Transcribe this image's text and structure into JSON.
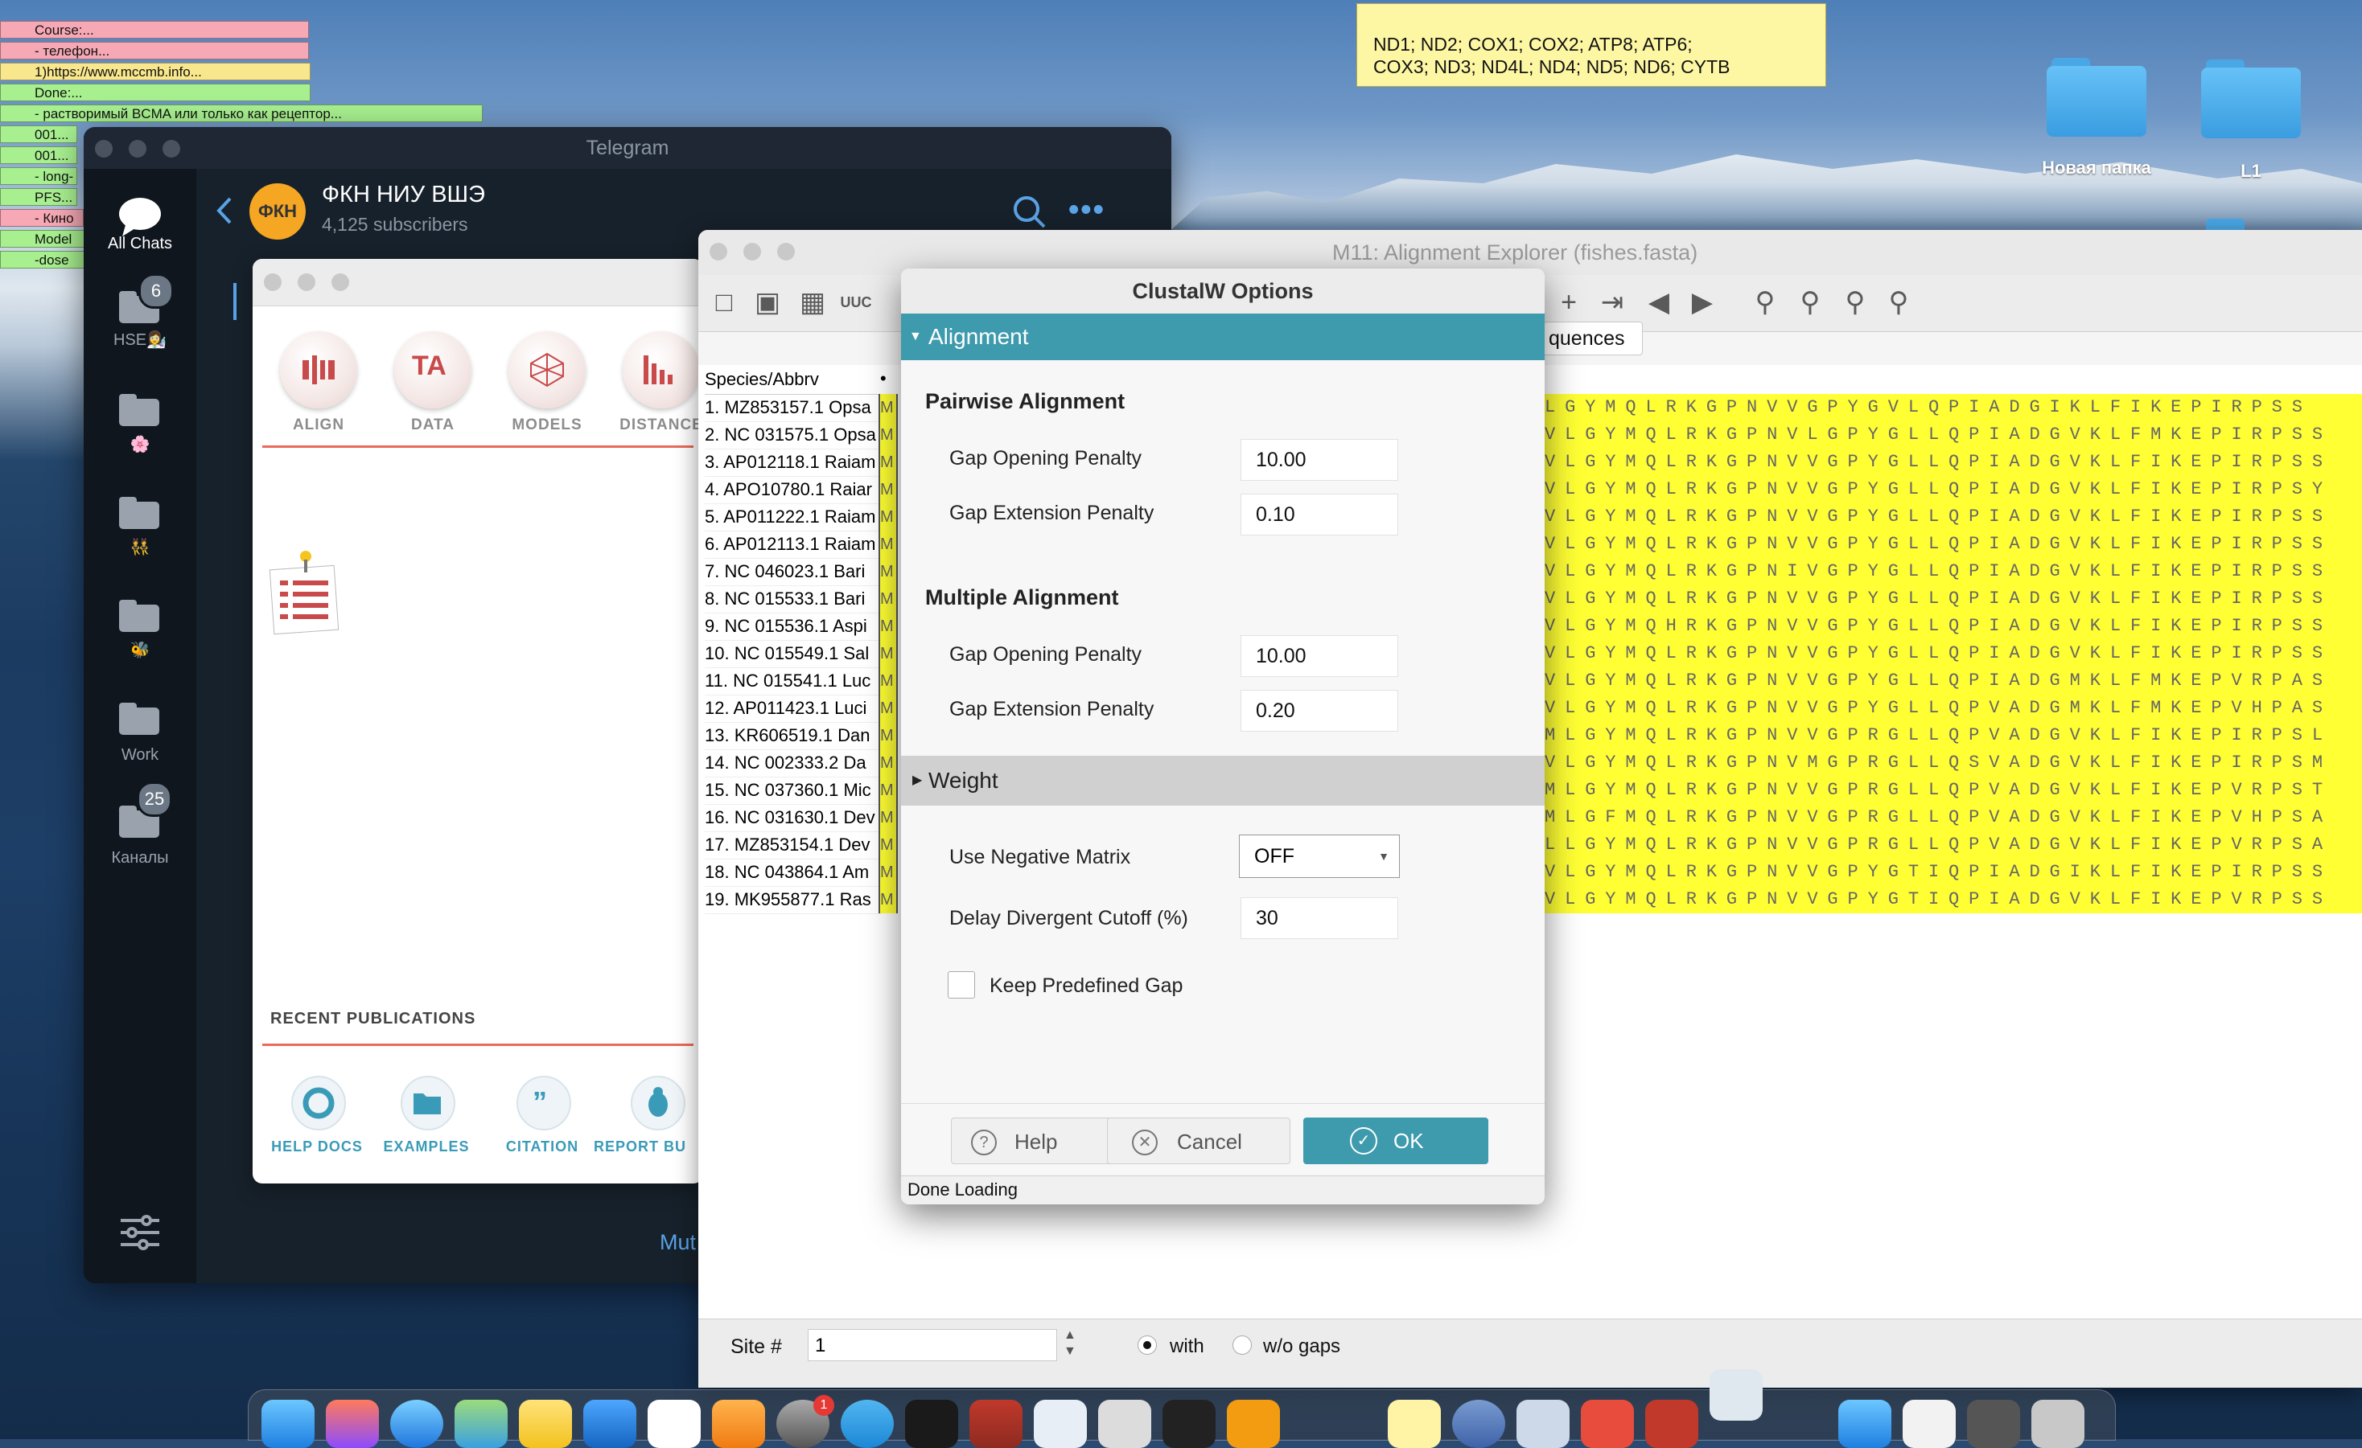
{
  "desktop": {
    "sticky_notes": [
      {
        "text": "Course:...",
        "color": "#f6a8b4"
      },
      {
        "text": "- телефон...",
        "color": "#f6a8b4"
      },
      {
        "text": "1)https://www.mccmb.info...",
        "color": "#f8e78c"
      },
      {
        "text": "Done:...",
        "color": "#a7ef8f"
      },
      {
        "text": "- растворимый BCMA или только как рецептор...",
        "color": "#a7ef8f"
      },
      {
        "text": "001...",
        "color": "#a7ef8f"
      },
      {
        "text": "001...",
        "color": "#a7ef8f"
      },
      {
        "text": "- long-",
        "color": "#a7ef8f"
      },
      {
        "text": "PFS...",
        "color": "#a7ef8f"
      },
      {
        "text": "- Кино",
        "color": "#f6a8b4"
      },
      {
        "text": "Model",
        "color": "#a7ef8f"
      },
      {
        "text": "-dose",
        "color": "#a7ef8f"
      }
    ],
    "yellow_note": {
      "line1": "ND1; ND2; COX1; COX2; ATP8; ATP6;",
      "line2": "COX3; ND3; ND4L; ND4; ND5; ND6; CYTB"
    },
    "folders": [
      "Новая папка",
      "L1"
    ]
  },
  "telegram": {
    "window_title": "Telegram",
    "sidebar": [
      {
        "label": "All Chats",
        "badge": ""
      },
      {
        "label": "HSE👩‍🔬",
        "badge": "6"
      },
      {
        "label": "🌸",
        "badge": ""
      },
      {
        "label": "👯",
        "badge": ""
      },
      {
        "label": "🐝",
        "badge": ""
      },
      {
        "label": "Work",
        "badge": ""
      },
      {
        "label": "Каналы",
        "badge": "25"
      }
    ],
    "channel": {
      "avatar": "ФКН",
      "name": "ФКН НИУ ВШЭ",
      "subscribers": "4,125 subscribers"
    },
    "bottom_partial": "Mut"
  },
  "mega_app": {
    "nav": [
      "ALIGN",
      "DATA",
      "MODELS",
      "DISTANCE"
    ],
    "recent_publications": "RECENT PUBLICATIONS",
    "help_items": [
      "HELP DOCS",
      "EXAMPLES",
      "CITATION",
      "REPORT BU"
    ]
  },
  "alignment_explorer": {
    "title": "M11: Alignment Explorer (fishes.fasta)",
    "tab_partial": "quences",
    "species_header": "Species/Abbrv",
    "species": [
      "1. MZ853157.1 Opsa",
      "2. NC 031575.1 Opsa",
      "3. AP012118.1 Raiam",
      "4. APO10780.1 Raiar",
      "5. AP011222.1 Raiam",
      "6. AP012113.1 Raiam",
      "7. NC 046023.1 Bari",
      "8. NC 015533.1 Bari",
      "9. NC 015536.1 Aspi",
      "10. NC 015549.1 Sal",
      "11. NC 015541.1 Luc",
      "12. AP011423.1 Luci",
      "13. KR606519.1 Dan",
      "14. NC 002333.2 Da",
      "15. NC 037360.1 Mic",
      "16. NC 031630.1 Dev",
      "17. MZ853154.1 Dev",
      "18. NC 043864.1 Am",
      "19. MK955877.1 Ras"
    ],
    "sequences": [
      "LGYMQLRKGPNVVGPYGVLQPIADGIKLFIKEPIRPSS",
      "VLGYMQLRKGPNVLGPYGLLQPIADGVKLFMKEPIRPSS",
      "VLGYMQLRKGPNVVGPYGLLQPIADGVKLFIKEPIRPSS",
      "VLGYMQLRKGPNVVGPYGLLQPIADGVKLFIKEPIRPSY",
      "VLGYMQLRKGPNVVGPYGLLQPIADGVKLFIKEPIRPSS",
      "VLGYMQLRKGPNVVGPYGLLQPIADGVKLFIKEPIRPSS",
      "VLGYMQLRKGPNIVGPYGLLQPIADGVKLFIKEPIRPSS",
      "VLGYMQLRKGPNVVGPYGLLQPIADGVKLFIKEPIRPSS",
      "VLGYMQHRKGPNVVGPYGLLQPIADGVKLFIKEPIRPSS",
      "VLGYMQLRKGPNVVGPYGLLQPIADGVKLFIKEPIRPSS",
      "VLGYMQLRKGPNVVGPYGLLQPIADGMKLFMKEPVRPAS",
      "VLGYMQLRKGPNVVGPYGLLQPVADGMKLFMKEPVHPAS",
      "MLGYMQLRKGPNVVGPRGLLQPVADGVKLFIKEPIRPSL",
      "VLGYMQLRKGPNVMGPRGLLQSVADGVKLFIKEPIRPSM",
      "MLGYMQLRKGPNVVGPRGLLQPVADGVKLFIKEPVRPST",
      "MLGFMQLRKGPNVVGPRGLLQPVADGVKLFIKEPVHPSA",
      "LLGYMQLRKGPNVVGPRGLLQPVADGVKLFIKEPVRPSA",
      "VLGYMQLRKGPNVVGPYGTIQPIADGIKLFIKEPIRPSS",
      "VLGYMQLRKGPNVVGPYGTIQPIADGVKLFIKEPVRPSS"
    ],
    "site_label": "Site #",
    "site_value": "1",
    "with_label": "with",
    "without_label": "w/o gaps"
  },
  "clustalw": {
    "title": "ClustalW Options",
    "alignment_section": "Alignment",
    "pairwise": {
      "heading": "Pairwise Alignment",
      "gap_open_label": "Gap Opening Penalty",
      "gap_open_value": "10.00",
      "gap_ext_label": "Gap Extension Penalty",
      "gap_ext_value": "0.10"
    },
    "multiple": {
      "heading": "Multiple Alignment",
      "gap_open_label": "Gap Opening Penalty",
      "gap_open_value": "10.00",
      "gap_ext_label": "Gap Extension Penalty",
      "gap_ext_value": "0.20"
    },
    "weight_section": "Weight",
    "neg_matrix_label": "Use Negative Matrix",
    "neg_matrix_value": "OFF",
    "delay_label": "Delay Divergent Cutoff (%)",
    "delay_value": "30",
    "keep_gap_label": "Keep Predefined Gap",
    "help_button": "Help",
    "cancel_button": "Cancel",
    "ok_button": "OK",
    "status": "Done Loading"
  }
}
